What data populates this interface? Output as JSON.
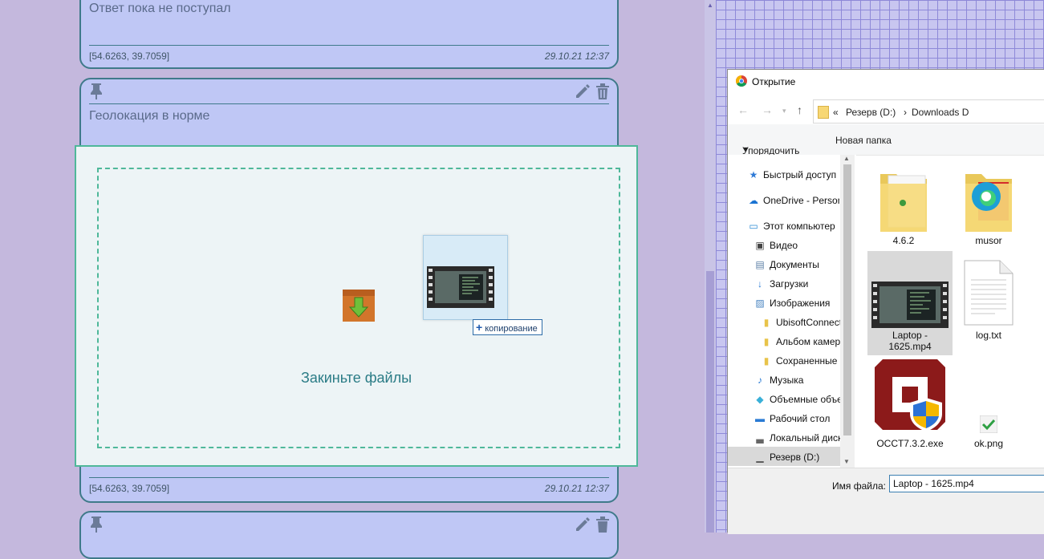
{
  "cards": [
    {
      "text": "Ответ пока не поступал",
      "coords": "[54.6263, 39.7059]",
      "date": "29.10.21 12:37"
    },
    {
      "text": "Геолокация в норме",
      "coords": "[54.6263, 39.7059]",
      "date": "29.10.21 12:37"
    }
  ],
  "dropzone": {
    "label": "Закиньте файлы",
    "copy_badge": "копирование"
  },
  "dialog": {
    "title": "Открытие",
    "address": {
      "prefix": "«",
      "drive": "Резерв (D:)",
      "folder": "Downloads D"
    },
    "toolbar": {
      "organize": "Упорядочить",
      "new_folder": "Новая папка"
    },
    "nav": [
      {
        "label": "Быстрый доступ",
        "icon": "star-icon"
      },
      {
        "label": "OneDrive - Personal",
        "icon": "cloud-icon"
      },
      {
        "label": "Этот компьютер",
        "icon": "computer-icon"
      },
      {
        "label": "Видео",
        "icon": "video-icon"
      },
      {
        "label": "Документы",
        "icon": "document-icon"
      },
      {
        "label": "Загрузки",
        "icon": "download-icon"
      },
      {
        "label": "Изображения",
        "icon": "image-icon"
      },
      {
        "label": "UbisoftConnect",
        "icon": "folder-icon"
      },
      {
        "label": "Альбом камеры",
        "icon": "folder-icon"
      },
      {
        "label": "Сохраненные",
        "icon": "folder-icon"
      },
      {
        "label": "Музыка",
        "icon": "music-icon"
      },
      {
        "label": "Объемные объекты",
        "icon": "cube-icon"
      },
      {
        "label": "Рабочий стол",
        "icon": "desktop-icon"
      },
      {
        "label": "Локальный диск",
        "icon": "disk-icon"
      },
      {
        "label": "Резерв (D:)",
        "icon": "drive-icon"
      }
    ],
    "files": [
      {
        "name": "4.6.2",
        "type": "folder"
      },
      {
        "name": "musor",
        "type": "folder"
      },
      {
        "name": "Laptop - 1625.mp4",
        "type": "video"
      },
      {
        "name": "log.txt",
        "type": "text"
      },
      {
        "name": "OCCT7.3.2.exe",
        "type": "exe"
      },
      {
        "name": "ok.png",
        "type": "image"
      }
    ],
    "filename_label": "Имя файла:",
    "filename_value": "Laptop - 1625.mp4"
  }
}
